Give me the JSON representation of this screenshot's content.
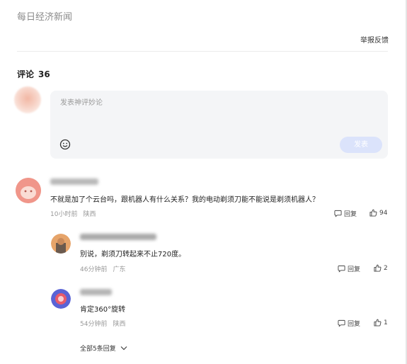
{
  "header": {
    "source_name": "每日经济新闻",
    "report_label": "举报反馈"
  },
  "comments_section": {
    "title": "评论",
    "count": "36"
  },
  "composer": {
    "placeholder": "发表神评妙论",
    "send_label": "发表"
  },
  "comments": [
    {
      "text": "不就是加了个云台吗，跟机器人有什么关系？我的电动剃须刀能不能说是剃须机器人？",
      "time": "10小时前",
      "location": "陕西",
      "reply_label": "回复",
      "likes": "94",
      "replies": [
        {
          "text": "别说，剃须刀转起来不止720度。",
          "time": "46分钟前",
          "location": "广东",
          "reply_label": "回复",
          "likes": "2"
        },
        {
          "text": "肯定360°旋转",
          "time": "54分钟前",
          "location": "陕西",
          "reply_label": "回复",
          "likes": "1"
        }
      ],
      "more_replies_label": "全部5条回复"
    }
  ],
  "colors": {
    "send_button_disabled": "#dbe3fb",
    "composer_bg": "#f4f5f7"
  }
}
